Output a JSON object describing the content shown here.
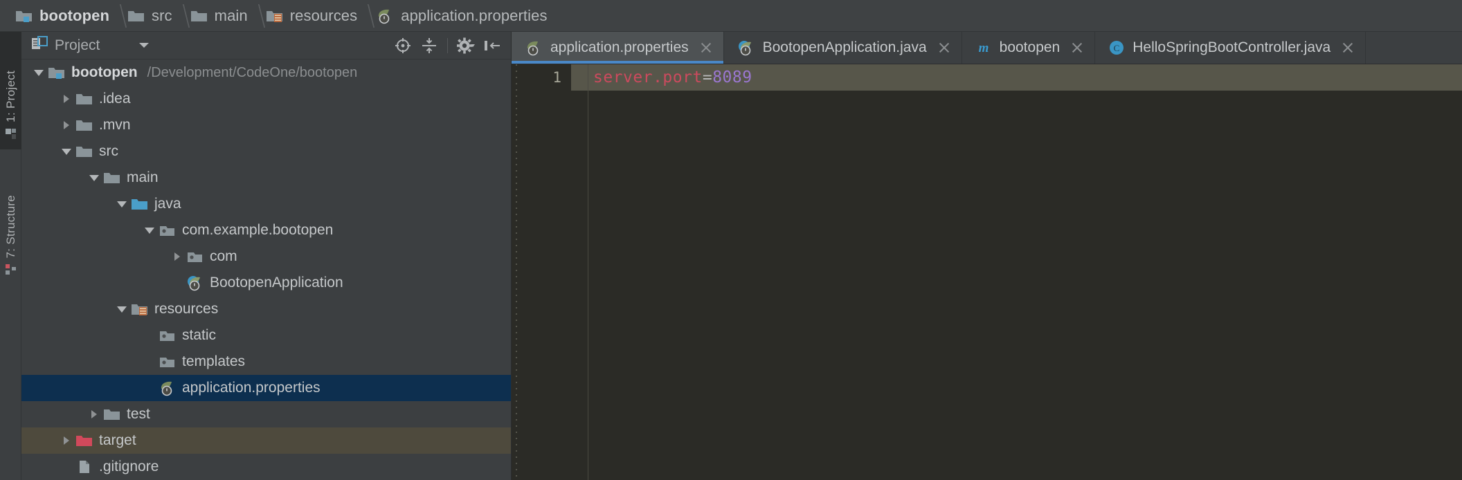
{
  "window": {
    "theme_bg": "#3c3f41",
    "editor_bg": "#2b2b26",
    "accent": "#4a88c7",
    "selection_bg": "#0d2f4f",
    "hover_bg": "#4e4a3d",
    "current_line_bg": "#57564a"
  },
  "breadcrumb": {
    "items": [
      {
        "label": "bootopen",
        "icon": "module-folder-icon"
      },
      {
        "label": "src",
        "icon": "folder-icon"
      },
      {
        "label": "main",
        "icon": "folder-icon"
      },
      {
        "label": "resources",
        "icon": "resources-folder-icon"
      },
      {
        "label": "application.properties",
        "icon": "spring-properties-icon"
      }
    ]
  },
  "side_rail": {
    "tabs": [
      {
        "label": "1: Project",
        "icon": "project-window-icon",
        "active": true
      },
      {
        "label": "7: Structure",
        "icon": "structure-window-icon",
        "active": false
      }
    ]
  },
  "project_panel": {
    "title": "Project",
    "title_icon": "project-view-icon",
    "dropdown_icon": "chevron-down-icon",
    "tools": [
      {
        "name": "locate-icon",
        "tooltip": "Select Opened File"
      },
      {
        "name": "collapse-all-icon",
        "tooltip": "Collapse All"
      },
      {
        "name": "settings-gear-icon",
        "tooltip": "Settings"
      },
      {
        "name": "hide-panel-icon",
        "tooltip": "Hide"
      }
    ],
    "tree": [
      {
        "label": "bootopen",
        "path": "/Development/CodeOne/bootopen",
        "indent": 0,
        "arrow": "open",
        "icon": "module-folder-icon",
        "bold": true,
        "state": "none"
      },
      {
        "label": ".idea",
        "path": "",
        "indent": 1,
        "arrow": "closed",
        "icon": "folder-icon",
        "bold": false,
        "state": "none"
      },
      {
        "label": ".mvn",
        "path": "",
        "indent": 1,
        "arrow": "closed",
        "icon": "folder-icon",
        "bold": false,
        "state": "none"
      },
      {
        "label": "src",
        "path": "",
        "indent": 1,
        "arrow": "open",
        "icon": "folder-icon",
        "bold": false,
        "state": "none"
      },
      {
        "label": "main",
        "path": "",
        "indent": 2,
        "arrow": "open",
        "icon": "folder-icon",
        "bold": false,
        "state": "none"
      },
      {
        "label": "java",
        "path": "",
        "indent": 3,
        "arrow": "open",
        "icon": "source-folder-icon",
        "bold": false,
        "state": "none"
      },
      {
        "label": "com.example.bootopen",
        "path": "",
        "indent": 4,
        "arrow": "open",
        "icon": "package-icon",
        "bold": false,
        "state": "none"
      },
      {
        "label": "com",
        "path": "",
        "indent": 5,
        "arrow": "closed",
        "icon": "package-icon",
        "bold": false,
        "state": "none"
      },
      {
        "label": "BootopenApplication",
        "path": "",
        "indent": 5,
        "arrow": "none",
        "icon": "spring-class-icon",
        "bold": false,
        "state": "none"
      },
      {
        "label": "resources",
        "path": "",
        "indent": 3,
        "arrow": "open",
        "icon": "resources-folder-icon",
        "bold": false,
        "state": "none"
      },
      {
        "label": "static",
        "path": "",
        "indent": 4,
        "arrow": "none",
        "icon": "package-icon",
        "bold": false,
        "state": "none"
      },
      {
        "label": "templates",
        "path": "",
        "indent": 4,
        "arrow": "none",
        "icon": "package-icon",
        "bold": false,
        "state": "none"
      },
      {
        "label": "application.properties",
        "path": "",
        "indent": 4,
        "arrow": "none",
        "icon": "spring-properties-icon",
        "bold": false,
        "state": "selected"
      },
      {
        "label": "test",
        "path": "",
        "indent": 2,
        "arrow": "closed",
        "icon": "folder-icon",
        "bold": false,
        "state": "none"
      },
      {
        "label": "target",
        "path": "",
        "indent": 1,
        "arrow": "closed",
        "icon": "excluded-folder-icon",
        "bold": false,
        "state": "hovered"
      },
      {
        "label": ".gitignore",
        "path": "",
        "indent": 1,
        "arrow": "none",
        "icon": "file-icon",
        "bold": false,
        "state": "none"
      }
    ]
  },
  "editor": {
    "tabs": [
      {
        "label": "application.properties",
        "icon": "spring-properties-icon",
        "active": true
      },
      {
        "label": "BootopenApplication.java",
        "icon": "spring-class-icon",
        "active": false
      },
      {
        "label": "bootopen",
        "icon": "maven-icon",
        "active": false
      },
      {
        "label": "HelloSpringBootController.java",
        "icon": "java-class-icon",
        "active": false
      }
    ],
    "lines": [
      {
        "number": "1",
        "key": "server.port",
        "eq": "=",
        "value": "8089"
      }
    ]
  }
}
